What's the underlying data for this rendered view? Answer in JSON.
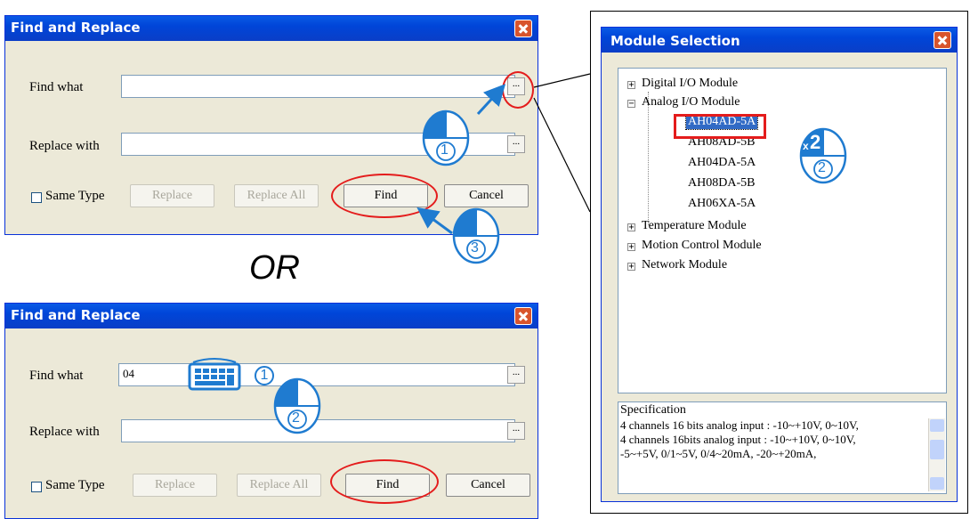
{
  "top_dialog": {
    "title": "Find and Replace",
    "find_what_label": "Find what",
    "find_what_value": "",
    "replace_with_label": "Replace with",
    "replace_with_value": "",
    "ellipsis": "...",
    "same_type_label": "Same Type",
    "replace_label": "Replace",
    "replace_all_label": "Replace All",
    "find_label": "Find",
    "cancel_label": "Cancel"
  },
  "or_text": "OR",
  "bottom_dialog": {
    "title": "Find and Replace",
    "find_what_label": "Find what",
    "find_what_value": "04",
    "replace_with_label": "Replace with",
    "replace_with_value": "",
    "ellipsis": "...",
    "same_type_label": "Same Type",
    "replace_label": "Replace",
    "replace_all_label": "Replace All",
    "find_label": "Find",
    "cancel_label": "Cancel"
  },
  "module_dialog": {
    "title": "Module Selection",
    "tree": {
      "digital": "Digital I/O Module",
      "analog": "Analog I/O Module",
      "items": [
        "AH04AD-5A",
        "AH08AD-5B",
        "AH04DA-5A",
        "AH08DA-5B",
        "AH06XA-5A"
      ],
      "temperature": "Temperature Module",
      "motion": "Motion Control Module",
      "network": "Network Module"
    },
    "spec_label": "Specification",
    "spec_lines": [
      "4 channels 16 bits analog input : -10~+10V, 0~10V,",
      "4 channels 16bits analog input : -10~+10V, 0~10V,",
      "-5~+5V, 0/1~5V, 0/4~20mA, -20~+20mA,"
    ]
  },
  "steps": {
    "one": "1",
    "two": "2",
    "three": "3",
    "x2_prefix": "x",
    "x2_num": "2"
  },
  "colors": {
    "title_blue": "#0054e3",
    "highlight_red": "#e41c1c",
    "step_blue": "#1f7bd0",
    "selected": "#316ac5"
  }
}
